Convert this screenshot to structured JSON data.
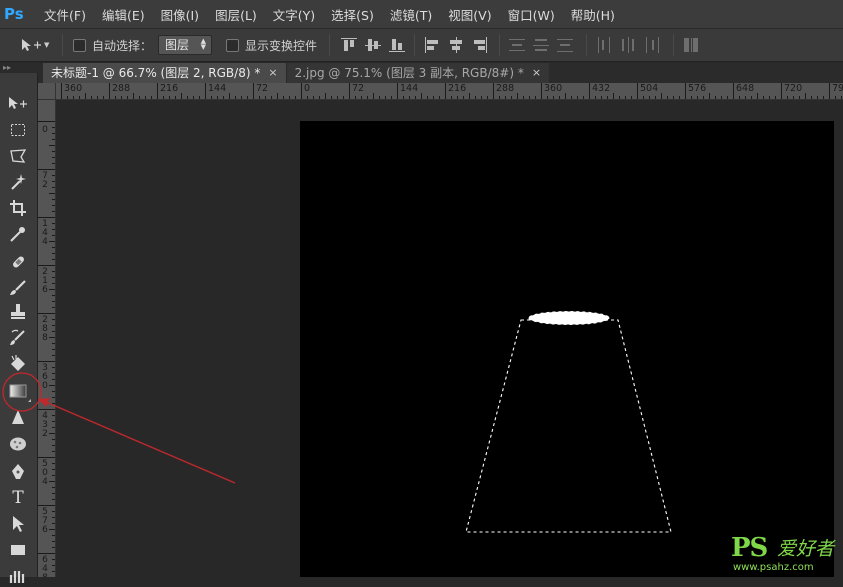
{
  "app": {
    "logo": "Ps"
  },
  "menu": [
    "文件(F)",
    "编辑(E)",
    "图像(I)",
    "图层(L)",
    "文字(Y)",
    "选择(S)",
    "滤镜(T)",
    "视图(V)",
    "窗口(W)",
    "帮助(H)"
  ],
  "options": {
    "auto_select_label": "自动选择：",
    "auto_select_value": "图层",
    "show_transform_label": "显示变换控件"
  },
  "tabs": [
    {
      "label": "未标题-1 @ 66.7% (图层 2, RGB/8) *",
      "close": "×"
    },
    {
      "label": "2.jpg @ 75.1% (图层 3 副本, RGB/8#) *",
      "close": "×"
    }
  ],
  "ruler_top": [
    "360",
    "288",
    "216",
    "144",
    "72",
    "0",
    "72",
    "144",
    "216",
    "288",
    "360",
    "432",
    "504",
    "576",
    "648",
    "720",
    "79"
  ],
  "ruler_left": [
    "0",
    "7\n2",
    "1\n4\n4",
    "2\n1\n6",
    "2\n8\n8",
    "3\n6\n0",
    "4\n3\n2",
    "5\n0\n4",
    "5\n7\n6",
    "6\n4\n8"
  ],
  "tools": [
    "move-tool",
    "marquee-tool",
    "lasso-tool",
    "magic-wand-tool",
    "crop-tool",
    "eyedropper-tool",
    "healing-brush-tool",
    "brush-tool",
    "clone-stamp-tool",
    "history-brush-tool",
    "eraser-tool",
    "gradient-tool",
    "blur-tool",
    "dodge-tool",
    "pen-tool",
    "type-tool",
    "path-selection-tool",
    "rectangle-tool",
    "hand-tool"
  ],
  "watermark": {
    "brand": "PS",
    "chinese": "爱好者",
    "url": "www.psahz.com"
  },
  "colors": {
    "accent_red": "#c0282d",
    "selection": "#ffffff",
    "ps_blue": "#31a8ff"
  }
}
